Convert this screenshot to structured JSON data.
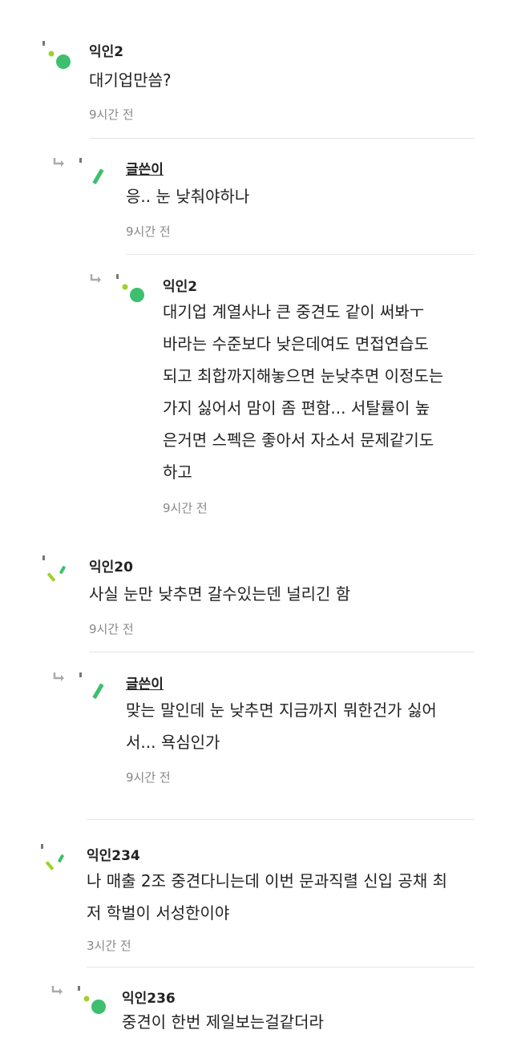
{
  "comments": [
    {
      "author": "익인2",
      "lines": [
        "대기업만씀?"
      ],
      "time": "9시간 전",
      "avatar": "dot-avatar"
    },
    {
      "author": "글쓴이",
      "lines": [
        "응.. 눈 낮춰야하나"
      ],
      "time": "9시간 전",
      "avatar": "stroke-avatar",
      "op": true,
      "reply": true
    },
    {
      "author": "익인2",
      "lines": [
        "대기업 계열사나 큰 중견도 같이 써봐ㅜ",
        "바라는 수준보다 낮은데여도 면접연습도",
        "되고 최합까지해놓으면 눈낮추면 이정도는",
        "가지 싫어서 맘이 좀 편함... 서탈률이 높",
        "은거면 스펙은 좋아서 자소서 문제같기도",
        "하고"
      ],
      "time": "9시간 전",
      "avatar": "dot-avatar",
      "reply": true
    },
    {
      "author": "익인20",
      "lines": [
        "사실 눈만 낮추면 갈수있는덴 널리긴 함"
      ],
      "time": "9시간 전",
      "avatar": "double-stroke-avatar"
    },
    {
      "author": "글쓴이",
      "lines": [
        "맞는 말인데 눈 낮추면 지금까지 뭐한건가 싫어",
        "서... 욕심인가"
      ],
      "time": "9시간 전",
      "avatar": "stroke-avatar",
      "op": true,
      "reply": true
    },
    {
      "author": "익인234",
      "lines": [
        "나 매출 2조 중견다니는데 이번 문과직렬 신입 공채 최",
        "저 학벌이 서성한이야"
      ],
      "time": "3시간 전",
      "avatar": "double-stroke-avatar"
    },
    {
      "author": "익인236",
      "lines": [
        "중견이 한번 제일보는걸같더라"
      ],
      "time": "",
      "avatar": "dot-avatar",
      "reply": true
    }
  ],
  "colors": {
    "green": "#3dbf6e",
    "lime": "#9ed12a",
    "text": "#222222",
    "muted": "#888888",
    "divider": "#e6e6e6"
  }
}
